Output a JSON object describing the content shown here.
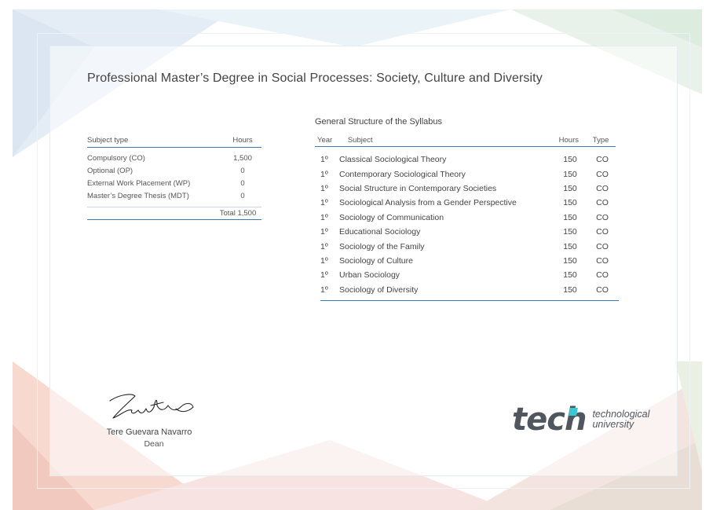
{
  "title": "Professional Master’s Degree in Social Processes: Society, Culture and Diversity",
  "summary": {
    "header": {
      "subject_type": "Subject type",
      "hours": "Hours"
    },
    "rows": [
      {
        "label": "Compulsory (CO)",
        "hours": "1,500"
      },
      {
        "label": "Optional (OP)",
        "hours": "0"
      },
      {
        "label": "External Work Placement (WP)",
        "hours": "0"
      },
      {
        "label": "Master’s Degree Thesis (MDT)",
        "hours": "0"
      }
    ],
    "total": "Total 1,500"
  },
  "syllabus": {
    "title": "General Structure of the Syllabus",
    "header": {
      "year": "Year",
      "subject": "Subject",
      "hours": "Hours",
      "type": "Type"
    },
    "rows": [
      {
        "year": "1º",
        "subject": "Classical Sociological Theory",
        "hours": "150",
        "type": "CO"
      },
      {
        "year": "1º",
        "subject": "Contemporary Sociological Theory",
        "hours": "150",
        "type": "CO"
      },
      {
        "year": "1º",
        "subject": "Social Structure in Contemporary Societies",
        "hours": "150",
        "type": "CO"
      },
      {
        "year": "1º",
        "subject": "Sociological Analysis from a Gender Perspective",
        "hours": "150",
        "type": "CO"
      },
      {
        "year": "1º",
        "subject": "Sociology of Communication",
        "hours": "150",
        "type": "CO"
      },
      {
        "year": "1º",
        "subject": "Educational Sociology",
        "hours": "150",
        "type": "CO"
      },
      {
        "year": "1º",
        "subject": "Sociology of the Family",
        "hours": "150",
        "type": "CO"
      },
      {
        "year": "1º",
        "subject": "Sociology of Culture",
        "hours": "150",
        "type": "CO"
      },
      {
        "year": "1º",
        "subject": "Urban Sociology",
        "hours": "150",
        "type": "CO"
      },
      {
        "year": "1º",
        "subject": "Sociology of Diversity",
        "hours": "150",
        "type": "CO"
      }
    ]
  },
  "signature": {
    "name": "Tere Guevara Navarro",
    "role": "Dean"
  },
  "logo": {
    "word": "tech",
    "tagline_1": "technological",
    "tagline_2": "university",
    "accent_color": "#37c9d6"
  },
  "colors": {
    "rule": "#3a7ab3",
    "text": "#444444"
  }
}
